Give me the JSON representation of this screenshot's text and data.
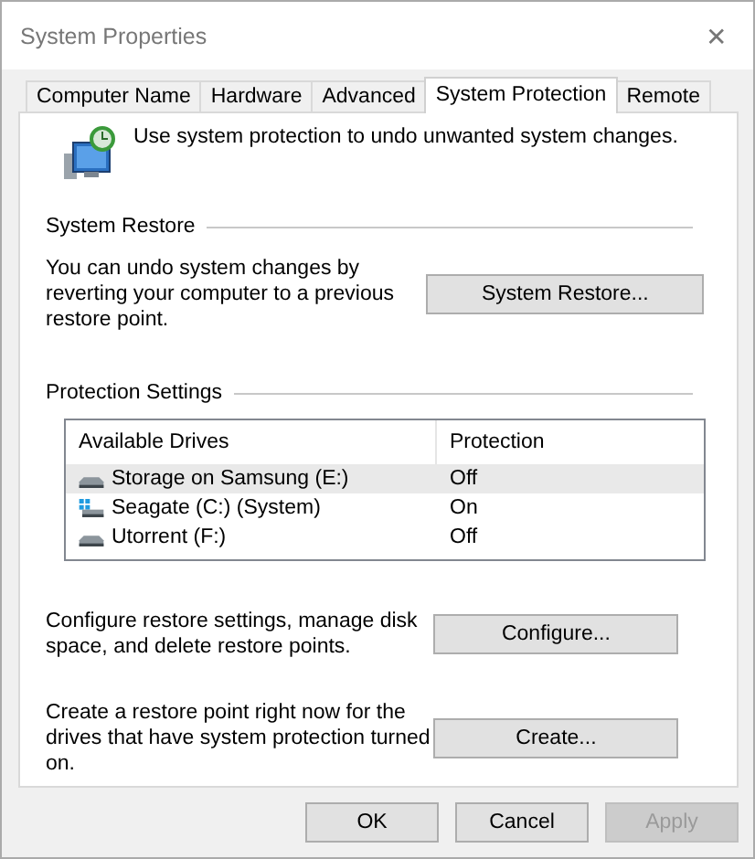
{
  "window": {
    "title": "System Properties",
    "close": "✕"
  },
  "tabs": [
    {
      "label": "Computer Name",
      "selected": false
    },
    {
      "label": "Hardware",
      "selected": false
    },
    {
      "label": "Advanced",
      "selected": false
    },
    {
      "label": "System Protection",
      "selected": true
    },
    {
      "label": "Remote",
      "selected": false
    }
  ],
  "intro": "Use system protection to undo unwanted system changes.",
  "system_restore": {
    "heading": "System Restore",
    "text": "You can undo system changes by reverting your computer to a previous restore point.",
    "button": "System Restore..."
  },
  "protection_settings": {
    "heading": "Protection Settings",
    "table": {
      "columns": [
        "Available Drives",
        "Protection"
      ],
      "rows": [
        {
          "drive": "Storage on Samsung (E:)",
          "protection": "Off",
          "kind": "disk",
          "selected": true
        },
        {
          "drive": "Seagate (C:) (System)",
          "protection": "On",
          "kind": "system",
          "selected": false
        },
        {
          "drive": "Utorrent (F:)",
          "protection": "Off",
          "kind": "disk",
          "selected": false
        }
      ]
    },
    "configure_text": "Configure restore settings, manage disk space, and delete restore points.",
    "configure_button": "Configure...",
    "create_text": "Create a restore point right now for the drives that have system protection turned on.",
    "create_button": "Create..."
  },
  "buttons": [
    {
      "label": "OK",
      "disabled": false
    },
    {
      "label": "Cancel",
      "disabled": false
    },
    {
      "label": "Apply",
      "disabled": true
    }
  ]
}
